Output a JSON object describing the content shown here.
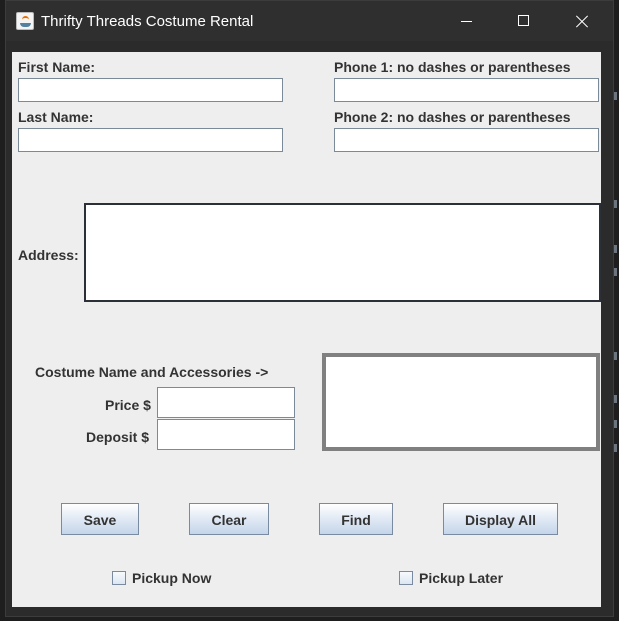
{
  "window": {
    "title": "Thrifty Threads Costume Rental"
  },
  "form": {
    "first_name": {
      "label": "First Name:",
      "value": ""
    },
    "last_name": {
      "label": "Last Name:",
      "value": ""
    },
    "phone1": {
      "label": "Phone 1: no dashes or parentheses",
      "value": ""
    },
    "phone2": {
      "label": "Phone 2: no dashes or parentheses",
      "value": ""
    },
    "address": {
      "label": "Address:",
      "value": ""
    },
    "costume": {
      "label": "Costume Name and Accessories ->",
      "value": ""
    },
    "price": {
      "label": "Price $",
      "value": ""
    },
    "deposit": {
      "label": "Deposit $",
      "value": ""
    }
  },
  "buttons": {
    "save": "Save",
    "clear": "Clear",
    "find": "Find",
    "display_all": "Display All"
  },
  "options": {
    "pickup_now": {
      "label": "Pickup Now",
      "checked": false
    },
    "pickup_later": {
      "label": "Pickup Later",
      "checked": false
    }
  }
}
